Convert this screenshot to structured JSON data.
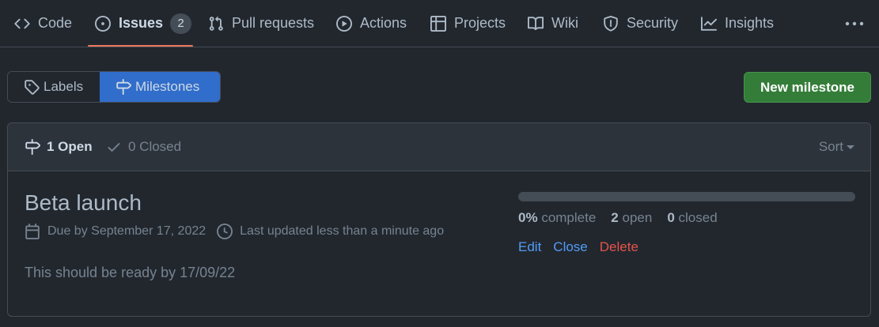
{
  "nav": {
    "items": [
      {
        "label": "Code",
        "icon": "code-icon"
      },
      {
        "label": "Issues",
        "icon": "issue-opened-icon",
        "count": "2"
      },
      {
        "label": "Pull requests",
        "icon": "git-pull-request-icon"
      },
      {
        "label": "Actions",
        "icon": "play-icon"
      },
      {
        "label": "Projects",
        "icon": "table-icon"
      },
      {
        "label": "Wiki",
        "icon": "book-icon"
      },
      {
        "label": "Security",
        "icon": "shield-icon"
      },
      {
        "label": "Insights",
        "icon": "graph-icon"
      }
    ],
    "active": "Issues",
    "more_icon": "kebab-horizontal-icon"
  },
  "subnav": {
    "labels": "Labels",
    "milestones": "Milestones"
  },
  "new_milestone_label": "New milestone",
  "filters": {
    "open_label": "1 Open",
    "closed_label": "0 Closed",
    "sort_label": "Sort"
  },
  "milestone": {
    "title": "Beta launch",
    "due": "Due by September 17, 2022",
    "updated": "Last updated less than a minute ago",
    "description": "This should be ready by 17/09/22",
    "progress_percent": 0,
    "complete_value": "0%",
    "complete_label": "complete",
    "open_value": "2",
    "open_label": "open",
    "closed_value": "0",
    "closed_label": "closed",
    "actions": {
      "edit": "Edit",
      "close": "Close",
      "delete": "Delete"
    }
  },
  "colors": {
    "background": "#22272e",
    "accent_blue": "#316dca",
    "primary_green": "#347d39",
    "danger": "#e5534b",
    "link": "#539bf5",
    "active_underline": "#ec775c"
  }
}
